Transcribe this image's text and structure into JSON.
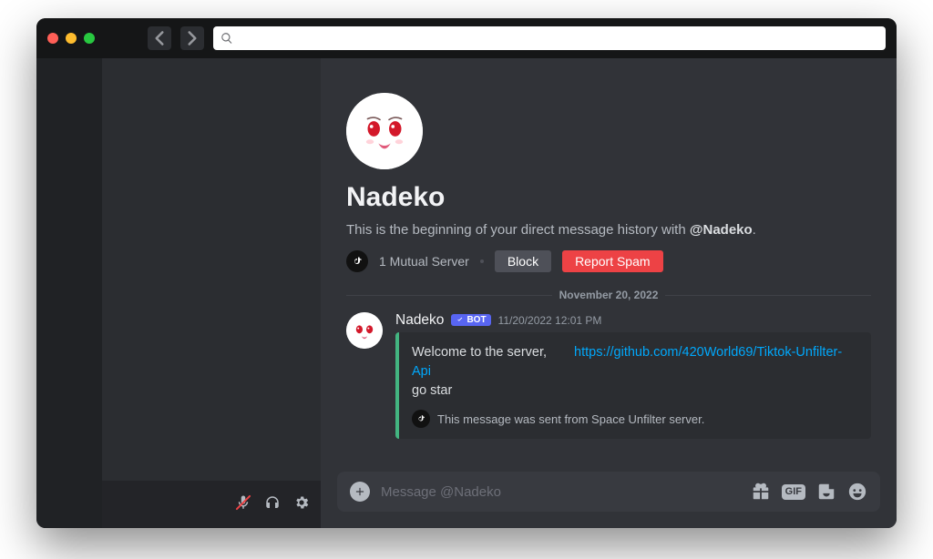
{
  "search": {
    "placeholder": ""
  },
  "dm": {
    "username": "Nadeko",
    "intro_prefix": "This is the beginning of your direct message history with ",
    "intro_mention": "@Nadeko",
    "intro_suffix": ".",
    "mutual": "1 Mutual Server",
    "block_label": "Block",
    "report_label": "Report Spam"
  },
  "divider": {
    "date": "November 20, 2022"
  },
  "message": {
    "author": "Nadeko",
    "bot_tag": "BOT",
    "timestamp": "11/20/2022 12:01 PM",
    "embed": {
      "line1": "Welcome to the server,",
      "link": "https://github.com/420World69/Tiktok-Unfilter-Api",
      "line2": "go star",
      "footer": "This message was sent from Space Unfilter server."
    }
  },
  "composer": {
    "placeholder": "Message @Nadeko"
  },
  "gif_label": "GIF"
}
